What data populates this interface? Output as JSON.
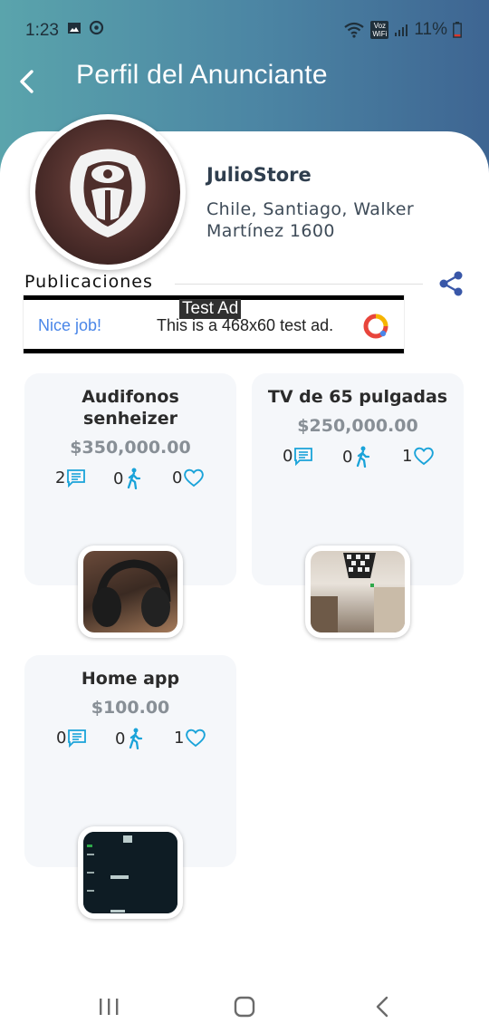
{
  "status_bar": {
    "time": "1:23",
    "network_label": "Voz WiFi",
    "battery": "11%"
  },
  "header": {
    "title": "Perfil del Anunciante"
  },
  "profile": {
    "name": "JulioStore",
    "address": "Chile, Santiago, Walker Martínez 1600"
  },
  "publications": {
    "label": "Publicaciones"
  },
  "ad": {
    "badge": "Test Ad",
    "left_text": "Nice job!",
    "main_text": "This is a 468x60 test ad."
  },
  "products": [
    {
      "title": "Audifonos senheizer",
      "price": "$350,000.00",
      "comments": "2",
      "visits": "0",
      "likes": "0"
    },
    {
      "title": "TV de 65 pulgadas",
      "price": "$250,000.00",
      "comments": "0",
      "visits": "0",
      "likes": "1"
    },
    {
      "title": "Home app",
      "price": "$100.00",
      "comments": "0",
      "visits": "0",
      "likes": "1"
    }
  ],
  "colors": {
    "header_gradient_start": "#5aa4ac",
    "header_gradient_end": "#3e6592",
    "accent_blue": "#1aa3d9",
    "share_blue": "#3957a8"
  }
}
